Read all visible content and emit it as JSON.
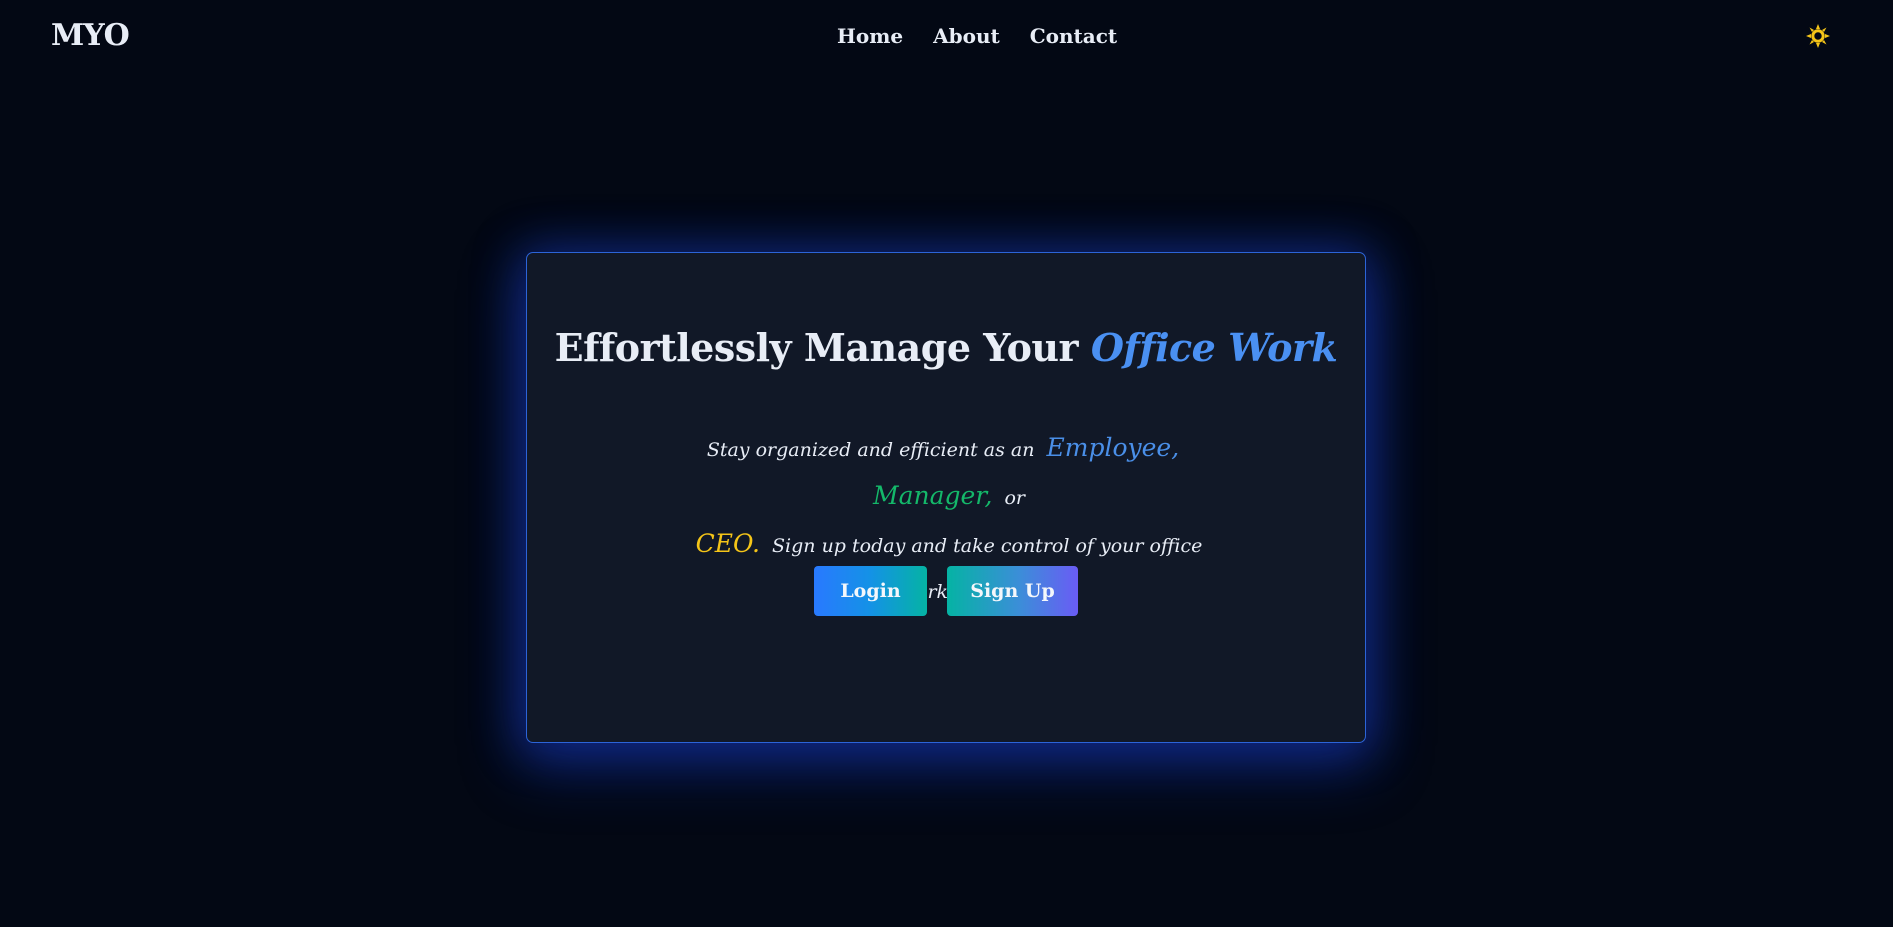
{
  "navbar": {
    "logo": "MYO",
    "links": [
      "Home",
      "About",
      "Contact"
    ],
    "theme_icon": "sun-icon",
    "theme_icon_color": "#f5c518"
  },
  "hero": {
    "headline_prefix": "Effortlessly Manage Your",
    "headline_accent": "Office Work",
    "sub_intro": "Stay organized and efficient as an",
    "role_employee": "Employee,",
    "role_manager": "Manager,",
    "sub_or": "or",
    "role_ceo": "CEO.",
    "sub_outro": "Sign up today and take control of your office workflow."
  },
  "buttons": {
    "login": "Login",
    "signup": "Sign Up"
  },
  "colors": {
    "background": "#030814",
    "card": "#111827",
    "card_border": "#2c64d8",
    "accent_blue": "#4a90f2",
    "employee": "#4a8fe8",
    "manager": "#14b86a",
    "ceo": "#f5c518"
  }
}
